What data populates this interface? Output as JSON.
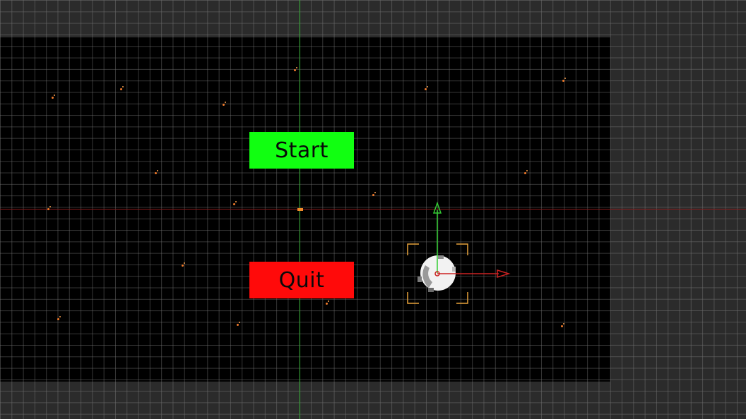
{
  "menu": {
    "start_label": "Start",
    "quit_label": "Quit",
    "start_color": "#11ff11",
    "quit_color": "#ff0a0a"
  },
  "scene": {
    "canvas_background": "#000000",
    "editor_background": "#2b2b2b",
    "x_axis_color": "#8a1a1a",
    "y_axis_color": "#2fae2f",
    "star_color": "#f07a2a",
    "selection_color": "#e8a33a"
  },
  "icons": {
    "player": "planet-sprite-icon",
    "move_gizmo_x": "arrow-right-icon",
    "move_gizmo_y": "arrow-up-icon",
    "selection": "selection-brackets-icon",
    "stars": "star-particle-icon"
  }
}
